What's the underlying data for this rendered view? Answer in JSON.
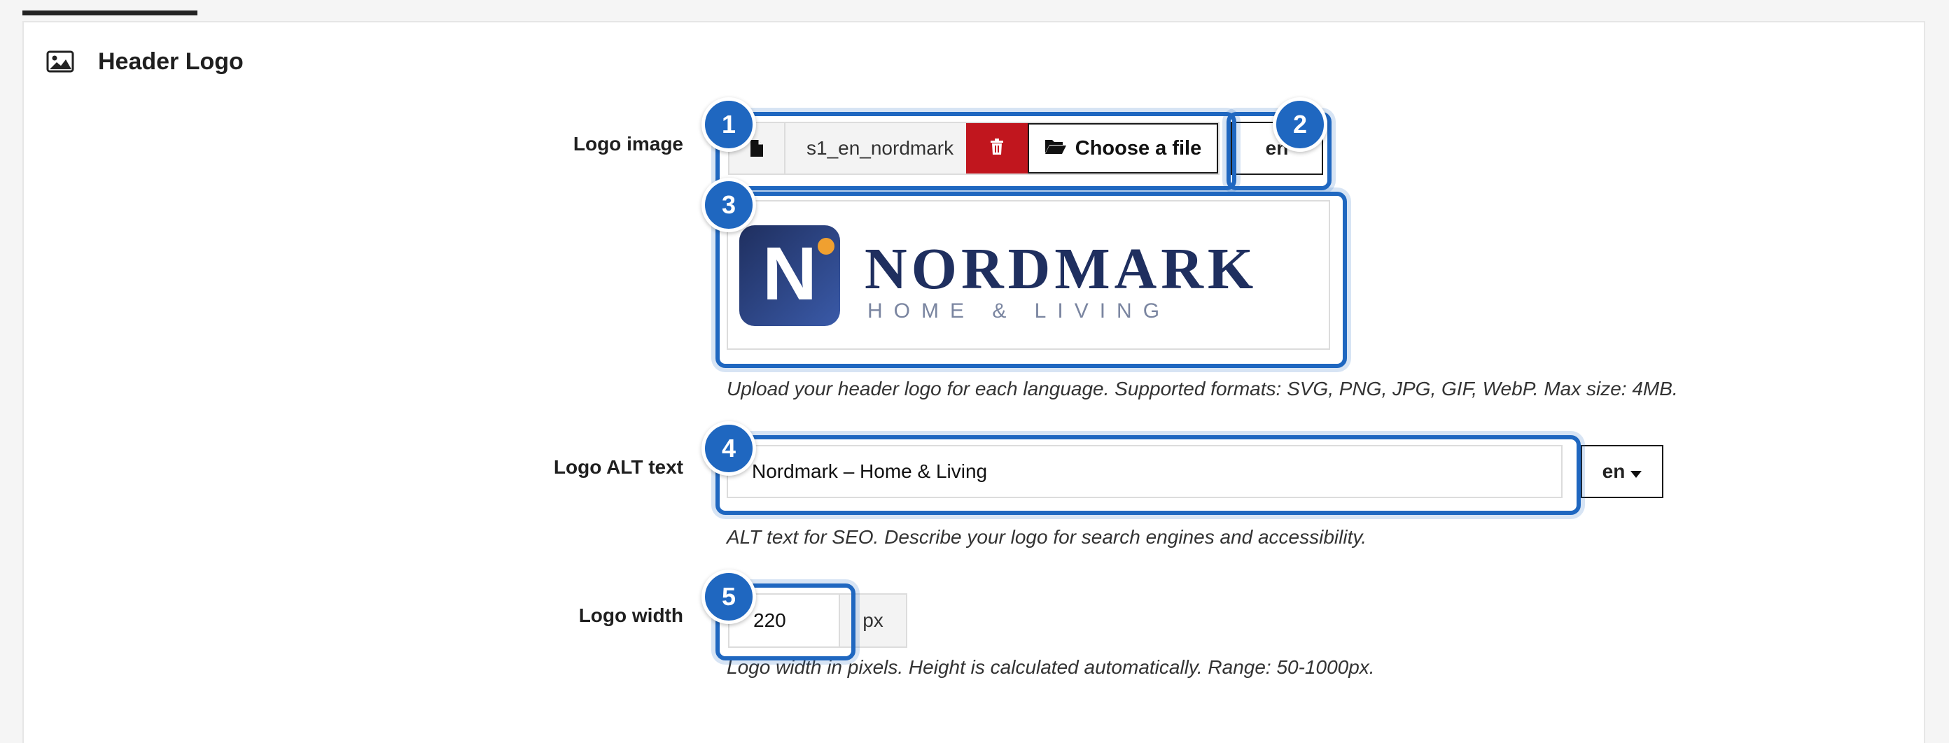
{
  "section": {
    "title": "Header Logo",
    "icon": "image-icon"
  },
  "logo_image": {
    "label": "Logo image",
    "filename": "s1_en_nordmark",
    "choose_label": "Choose a file",
    "language": "en",
    "help": "Upload your header logo for each language. Supported formats: SVG, PNG, JPG, GIF, WebP. Max size: 4MB."
  },
  "logo_preview": {
    "brand_initial": "N",
    "brand_name": "NORDMARK",
    "brand_tagline": "HOME & LIVING"
  },
  "logo_alt": {
    "label": "Logo ALT text",
    "value": "Nordmark – Home & Living",
    "language": "en",
    "help": "ALT text for SEO. Describe your logo for search engines and accessibility."
  },
  "logo_width": {
    "label": "Logo width",
    "value": "220",
    "unit": "px",
    "help": "Logo width in pixels. Height is calculated automatically. Range: 50-1000px."
  },
  "annotations": [
    "1",
    "2",
    "3",
    "4",
    "5"
  ],
  "colors": {
    "highlight": "#1f67c0",
    "delete": "#c1161e",
    "brand_navy": "#1f2f5f",
    "brand_dot": "#f0a030"
  }
}
